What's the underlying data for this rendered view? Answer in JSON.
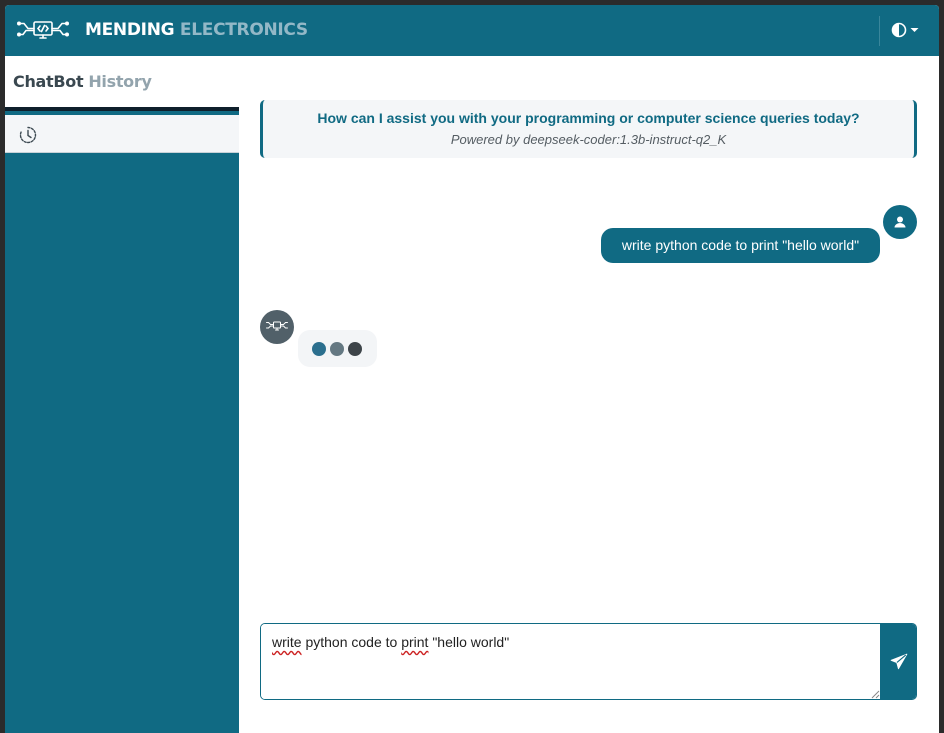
{
  "app": {
    "brand_word1": "MENDING",
    "brand_word2": "ELECTRONICS"
  },
  "sidebar": {
    "title_word1": "ChatBot",
    "title_word2": "History"
  },
  "chat": {
    "welcome_title": "How can I assist you with your programming or computer science queries today?",
    "welcome_subtitle": "Powered by deepseek-coder:1.3b-instruct-q2_K",
    "messages": [
      {
        "role": "user",
        "text": "write python code to print \"hello world\""
      }
    ],
    "bot_status": "typing"
  },
  "composer": {
    "value_part1": "write",
    "value_part2": " python code to ",
    "value_part3": "print",
    "value_part4": " \"hello world\""
  },
  "colors": {
    "primary": "#106a83",
    "sidebar_bg": "#106a83",
    "dot1": "#2b6f8e",
    "dot2": "#647882",
    "dot3": "#3d4449"
  },
  "icons": {
    "brand": "circuit-monitor-icon",
    "theme": "half-circle-contrast-icon",
    "history": "clock-history-icon",
    "user": "person-icon",
    "bot": "circuit-monitor-icon",
    "send": "paper-plane-icon"
  }
}
